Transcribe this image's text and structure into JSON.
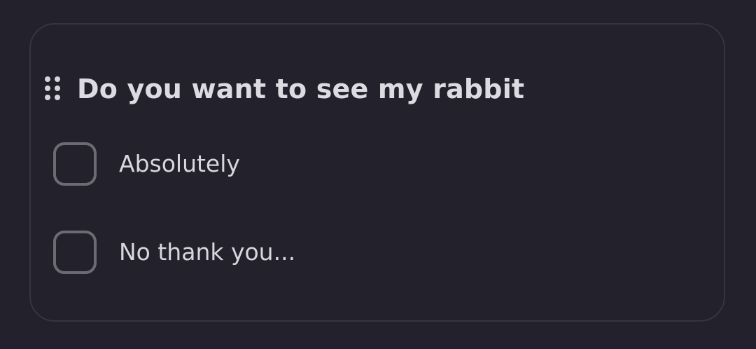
{
  "question": {
    "title": "Do you want to see my rabbit",
    "options": [
      {
        "label": "Absolutely",
        "checked": false
      },
      {
        "label": "No thank you...",
        "checked": false
      }
    ]
  },
  "icons": {
    "drag_handle": "drag-handle-icon",
    "checkbox": "checkbox-unchecked-icon"
  },
  "colors": {
    "background": "#22212c",
    "card_border": "#35343f",
    "text": "#dcdbe1",
    "checkbox_border": "#6c6b73"
  }
}
